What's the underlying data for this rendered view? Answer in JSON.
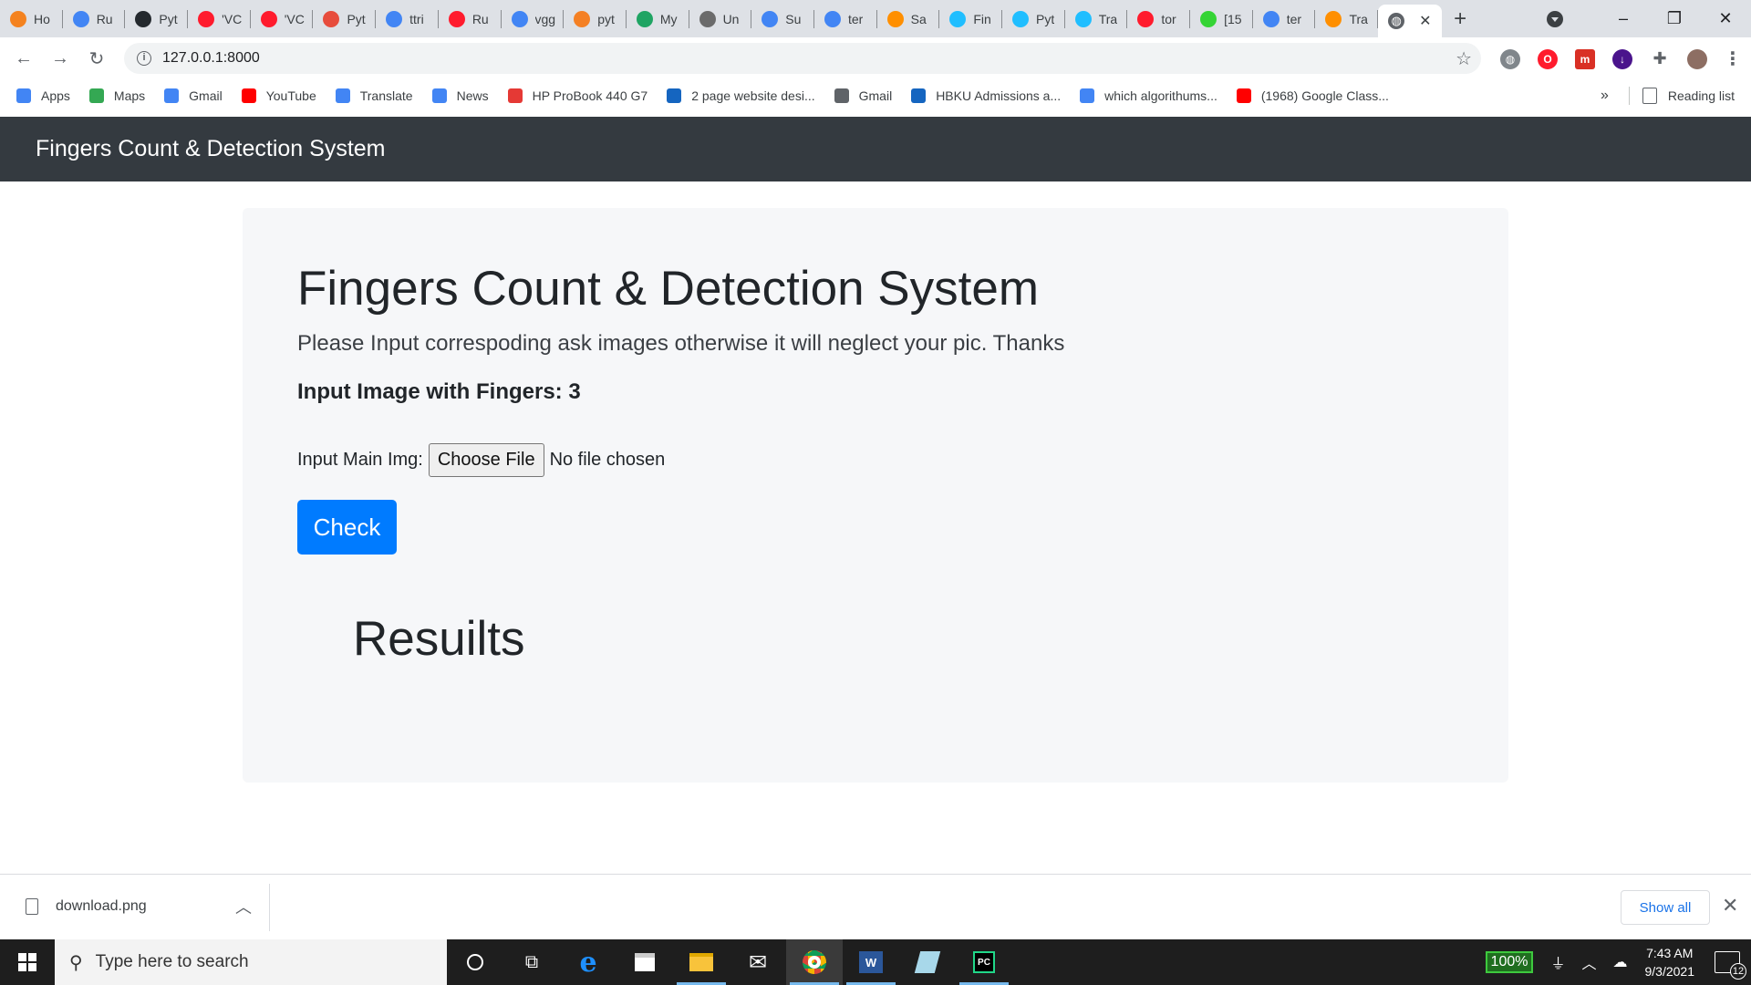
{
  "browser": {
    "tabs": [
      {
        "title": "Ho",
        "icon": "loading-icon",
        "color": "#f4821f"
      },
      {
        "title": "Ru",
        "icon": "google-icon",
        "color": "#4285f4"
      },
      {
        "title": "Pyt",
        "icon": "github-icon",
        "color": "#24292e"
      },
      {
        "title": "'VC",
        "icon": "opera-icon",
        "color": "#ff1b2d"
      },
      {
        "title": "'VC",
        "icon": "opera-icon",
        "color": "#ff1b2d"
      },
      {
        "title": "Pyt",
        "icon": "c-icon",
        "color": "#e74c3c"
      },
      {
        "title": "ttri",
        "icon": "google-icon",
        "color": "#4285f4"
      },
      {
        "title": "Ru",
        "icon": "opera-icon",
        "color": "#ff1b2d"
      },
      {
        "title": "vgg",
        "icon": "google-icon",
        "color": "#4285f4"
      },
      {
        "title": "pyt",
        "icon": "stackoverflow-icon",
        "color": "#f48024"
      },
      {
        "title": "My",
        "icon": "drive-icon",
        "color": "#1fa463"
      },
      {
        "title": "Un",
        "icon": "colab-icon",
        "color": "#6b6b6b"
      },
      {
        "title": "Su",
        "icon": "google-icon",
        "color": "#4285f4"
      },
      {
        "title": "ter",
        "icon": "google-icon",
        "color": "#4285f4"
      },
      {
        "title": "Sa",
        "icon": "tensorflow-icon",
        "color": "#ff8f00"
      },
      {
        "title": "Fin",
        "icon": "kaggle-icon",
        "color": "#20beff"
      },
      {
        "title": "Pyt",
        "icon": "kaggle-icon",
        "color": "#20beff"
      },
      {
        "title": "Tra",
        "icon": "kaggle-icon",
        "color": "#20beff"
      },
      {
        "title": "tor",
        "icon": "opera-icon",
        "color": "#ff1b2d"
      },
      {
        "title": "[15",
        "icon": "smiley-icon",
        "color": "#35d435"
      },
      {
        "title": "ter",
        "icon": "google-icon",
        "color": "#4285f4"
      },
      {
        "title": "Tra",
        "icon": "tensorflow-icon",
        "color": "#ff8f00"
      }
    ],
    "active_tab": {
      "icon": "globe-icon"
    },
    "address": "127.0.0.1:8000",
    "bookmarks": [
      {
        "label": "Apps",
        "icon": "apps-grid-icon",
        "color": "#4285f4"
      },
      {
        "label": "Maps",
        "icon": "maps-pin-icon",
        "color": "#34a853"
      },
      {
        "label": "Gmail",
        "icon": "google-icon",
        "color": "#4285f4"
      },
      {
        "label": "YouTube",
        "icon": "youtube-icon",
        "color": "#ff0000"
      },
      {
        "label": "Translate",
        "icon": "translate-icon",
        "color": "#4285f4"
      },
      {
        "label": "News",
        "icon": "news-icon",
        "color": "#4285f4"
      },
      {
        "label": "HP ProBook 440 G7",
        "icon": "ml-icon",
        "color": "#e53935"
      },
      {
        "label": "2 page website desi...",
        "icon": "y-icon",
        "color": "#1565c0"
      },
      {
        "label": "Gmail",
        "icon": "globe-icon",
        "color": "#5f6368"
      },
      {
        "label": "HBKU Admissions a...",
        "icon": "hbku-icon",
        "color": "#1565c0"
      },
      {
        "label": "which algorithums...",
        "icon": "google-icon",
        "color": "#4285f4"
      },
      {
        "label": "(1968) Google Class...",
        "icon": "youtube-icon",
        "color": "#ff0000"
      }
    ],
    "reading_list": "Reading list",
    "more_bookmarks": "»"
  },
  "page": {
    "navbar_brand": "Fingers Count & Detection System",
    "heading": "Fingers Count & Detection System",
    "lead": "Please Input correspoding ask images otherwise it will neglect your pic. Thanks",
    "subheading": "Input Image with Fingers: 3",
    "input_label": "Input Main Img:",
    "choose_file_label": "Choose File",
    "no_file_text": "No file chosen",
    "check_label": "Check",
    "results_heading": "Resuilts"
  },
  "downloads": {
    "file_name": "download.png",
    "show_all": "Show all"
  },
  "taskbar": {
    "search_placeholder": "Type here to search",
    "battery": "100%",
    "time": "7:43 AM",
    "date": "9/3/2021",
    "notification_count": "12"
  }
}
